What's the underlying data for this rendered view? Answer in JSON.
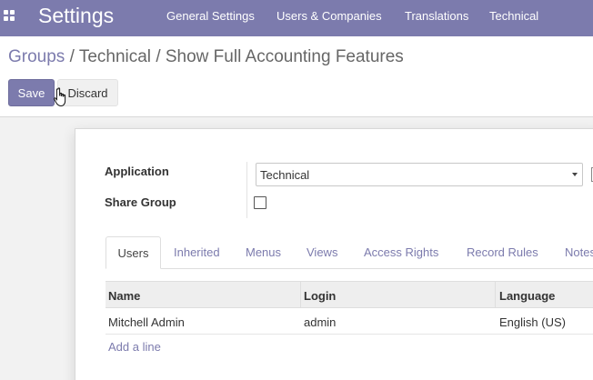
{
  "topbar": {
    "app_title": "Settings",
    "apps_icon": "apps-grid-icon",
    "menu": [
      {
        "label": "General Settings"
      },
      {
        "label": "Users & Companies"
      },
      {
        "label": "Translations"
      },
      {
        "label": "Technical"
      }
    ],
    "accent_color": "#7c7bad"
  },
  "breadcrumb": {
    "items": [
      "Groups",
      "Technical",
      "Show Full Accounting Features"
    ],
    "separator": "/"
  },
  "buttons": {
    "save_label": "Save",
    "discard_label": "Discard"
  },
  "form": {
    "application_label": "Application",
    "application_value": "Technical",
    "share_group_label": "Share Group",
    "share_group_checked": false
  },
  "tabs": [
    {
      "label": "Users",
      "active": true
    },
    {
      "label": "Inherited"
    },
    {
      "label": "Menus"
    },
    {
      "label": "Views"
    },
    {
      "label": "Access Rights"
    },
    {
      "label": "Record Rules"
    },
    {
      "label": "Notes"
    }
  ],
  "table": {
    "columns": [
      "Name",
      "Login",
      "Language"
    ],
    "rows": [
      {
        "name": "Mitchell Admin",
        "login": "admin",
        "language": "English (US)"
      }
    ],
    "add_line_label": "Add a line"
  }
}
